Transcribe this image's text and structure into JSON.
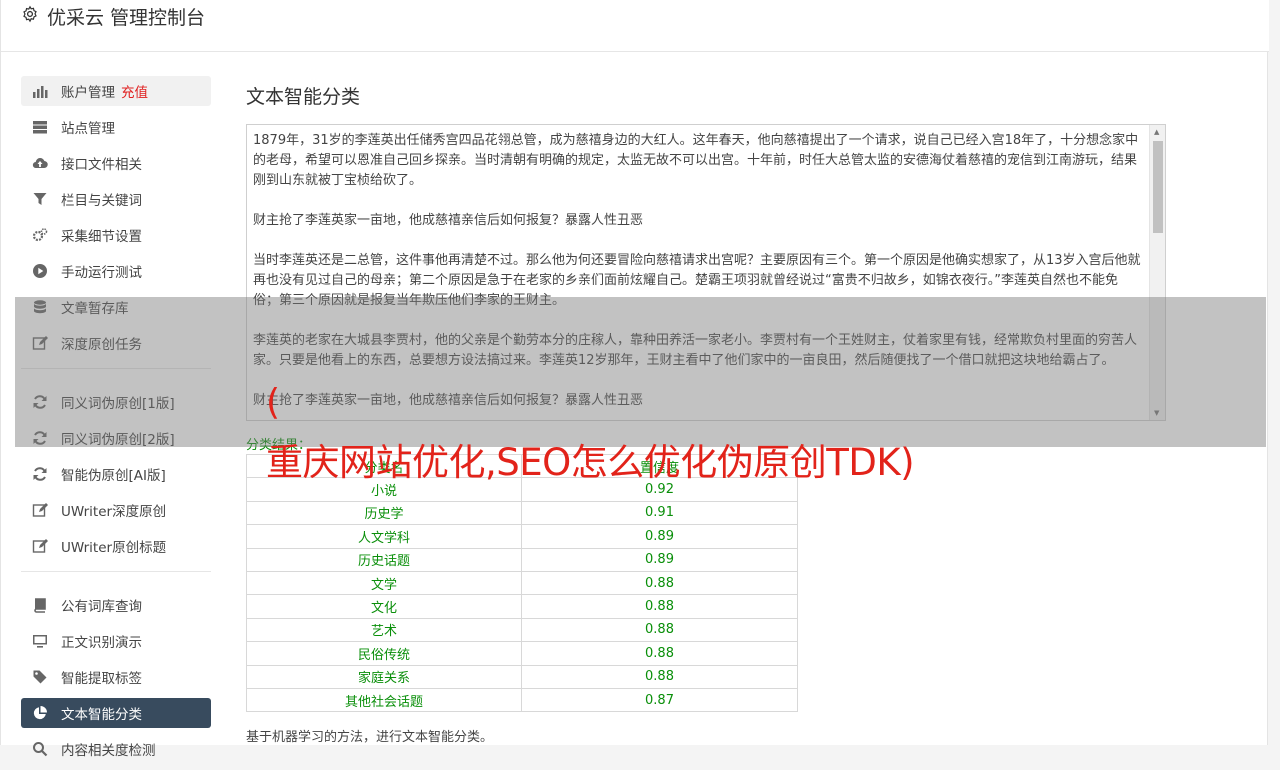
{
  "header": {
    "title": "优采云 管理控制台",
    "icon": "gear-icon"
  },
  "sidebar": {
    "groups": [
      [
        {
          "label": "账户管理",
          "extra": "充值",
          "icon": "bar-chart-icon"
        },
        {
          "label": "站点管理",
          "icon": "server-icon"
        },
        {
          "label": "接口文件相关",
          "icon": "cloud-upload-icon"
        },
        {
          "label": "栏目与关键词",
          "icon": "filter-icon"
        },
        {
          "label": "采集细节设置",
          "icon": "gears-icon"
        },
        {
          "label": "手动运行测试",
          "icon": "play-circle-icon"
        },
        {
          "label": "文章暂存库",
          "icon": "database-icon"
        },
        {
          "label": "深度原创任务",
          "icon": "edit-icon"
        }
      ],
      [
        {
          "label": "同义词伪原创[1版]",
          "icon": "refresh-icon"
        },
        {
          "label": "同义词伪原创[2版]",
          "icon": "refresh-icon"
        },
        {
          "label": "智能伪原创[AI版]",
          "icon": "refresh-icon"
        },
        {
          "label": "UWriter深度原创",
          "icon": "edit-icon"
        },
        {
          "label": "UWriter原创标题",
          "icon": "edit-icon"
        }
      ],
      [
        {
          "label": "公有词库查询",
          "icon": "book-icon"
        },
        {
          "label": "正文识别演示",
          "icon": "monitor-icon"
        },
        {
          "label": "智能提取标签",
          "icon": "tag-icon"
        },
        {
          "label": "文本智能分类",
          "icon": "pie-chart-icon"
        },
        {
          "label": "内容相关度检测",
          "icon": "search-icon"
        }
      ]
    ]
  },
  "main": {
    "title": "文本智能分类",
    "paragraphs": [
      "1879年，31岁的李莲英出任储秀宫四品花翎总管，成为慈禧身边的大红人。这年春天，他向慈禧提出了一个请求，说自己已经入宫18年了，十分想念家中的老母，希望可以恩准自己回乡探亲。当时清朝有明确的规定，太监无故不可以出宫。十年前，时任大总管太监的安德海仗着慈禧的宠信到江南游玩，结果刚到山东就被丁宝桢给砍了。",
      "财主抢了李莲英家一亩地，他成慈禧亲信后如何报复？暴露人性丑恶",
      "当时李莲英还是二总管，这件事他再清楚不过。那么他为何还要冒险向慈禧请求出宫呢？主要原因有三个。第一个原因是他确实想家了，从13岁入宫后他就再也没有见过自己的母亲；第二个原因是急于在老家的乡亲们面前炫耀自己。楚霸王项羽就曾经说过“富贵不归故乡，如锦衣夜行。”李莲英自然也不能免俗；第三个原因就是报复当年欺压他们李家的王财主。",
      "李莲英的老家在大城县李贾村，他的父亲是个勤劳本分的庄稼人，靠种田养活一家老小。李贾村有一个王姓财主，仗着家里有钱，经常欺负村里面的穷苦人家。只要是他看上的东西，总要想方设法搞过来。李莲英12岁那年，王财主看中了他们家中的一亩良田，然后随便找了一个借口就把这块地给霸占了。",
      "财主抢了李莲英家一亩地，他成慈禧亲信后如何报复？暴露人性丑恶"
    ],
    "result_label": "分类结果：",
    "table": {
      "headers": [
        "分类名",
        "置信度"
      ],
      "rows": [
        [
          "小说",
          "0.92"
        ],
        [
          "历史学",
          "0.91"
        ],
        [
          "人文学科",
          "0.89"
        ],
        [
          "历史话题",
          "0.89"
        ],
        [
          "文学",
          "0.88"
        ],
        [
          "文化",
          "0.88"
        ],
        [
          "艺术",
          "0.88"
        ],
        [
          "民俗传统",
          "0.88"
        ],
        [
          "家庭关系",
          "0.88"
        ],
        [
          "其他社会话题",
          "0.87"
        ]
      ]
    },
    "footnote": "基于机器学习的方法，进行文本智能分类。"
  },
  "overlay": {
    "paren": "(",
    "text": "重庆网站优化,SEO怎么优化伪原创TDK)"
  },
  "colors": {
    "active_nav": "#384b5e",
    "accent_red": "#e02020",
    "result_green": "#0a8f0a",
    "banner_red": "#e2231a"
  }
}
